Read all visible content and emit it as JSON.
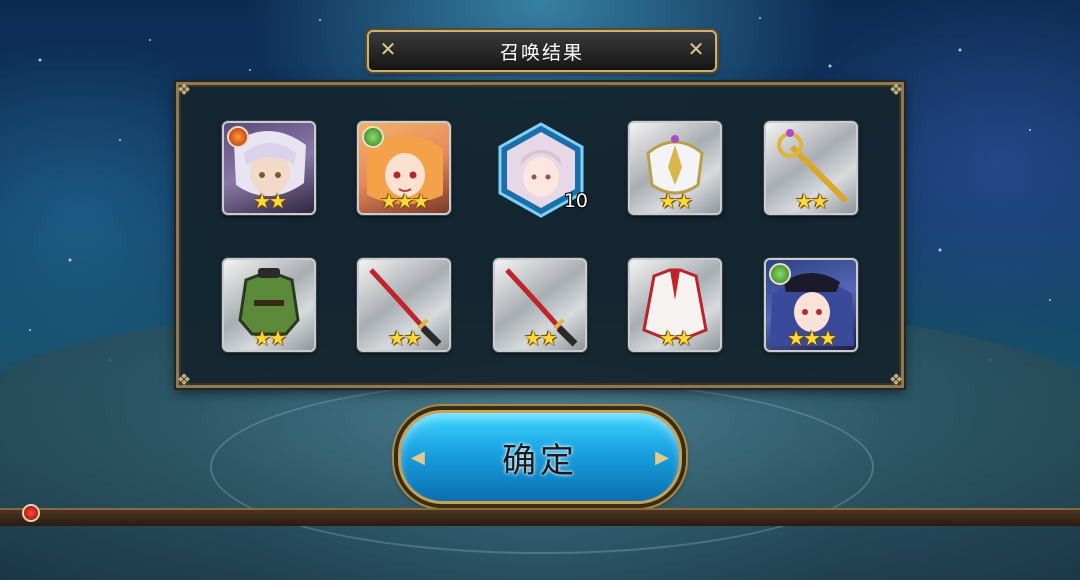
{
  "dialog": {
    "title": "召唤结果",
    "confirm_label": "确定"
  },
  "results": [
    {
      "kind": "hero",
      "name_icon": "silver-haired-hero-portrait",
      "element": "fire",
      "stars": "★★"
    },
    {
      "kind": "hero",
      "name_icon": "orange-haired-hero-portrait",
      "element": "wind",
      "stars": "★★★"
    },
    {
      "kind": "shard",
      "name_icon": "hero-shard-hexagon",
      "count": "10"
    },
    {
      "kind": "equipment",
      "name_icon": "helmet-icon",
      "stars": "★★"
    },
    {
      "kind": "equipment",
      "name_icon": "golden-scepter-icon",
      "stars": "★★"
    },
    {
      "kind": "equipment",
      "name_icon": "green-armor-icon",
      "stars": "★★"
    },
    {
      "kind": "equipment",
      "name_icon": "red-katana-icon",
      "stars": "★★"
    },
    {
      "kind": "equipment",
      "name_icon": "red-katana-icon",
      "stars": "★★"
    },
    {
      "kind": "equipment",
      "name_icon": "white-robe-icon",
      "stars": "★★"
    },
    {
      "kind": "hero",
      "name_icon": "blue-haired-officer-portrait",
      "element": "wind",
      "stars": "★★★"
    }
  ],
  "colors": {
    "star": "#ffd93b",
    "panel_border": "#8a7a5a",
    "confirm_button": "#1aa0e0"
  }
}
